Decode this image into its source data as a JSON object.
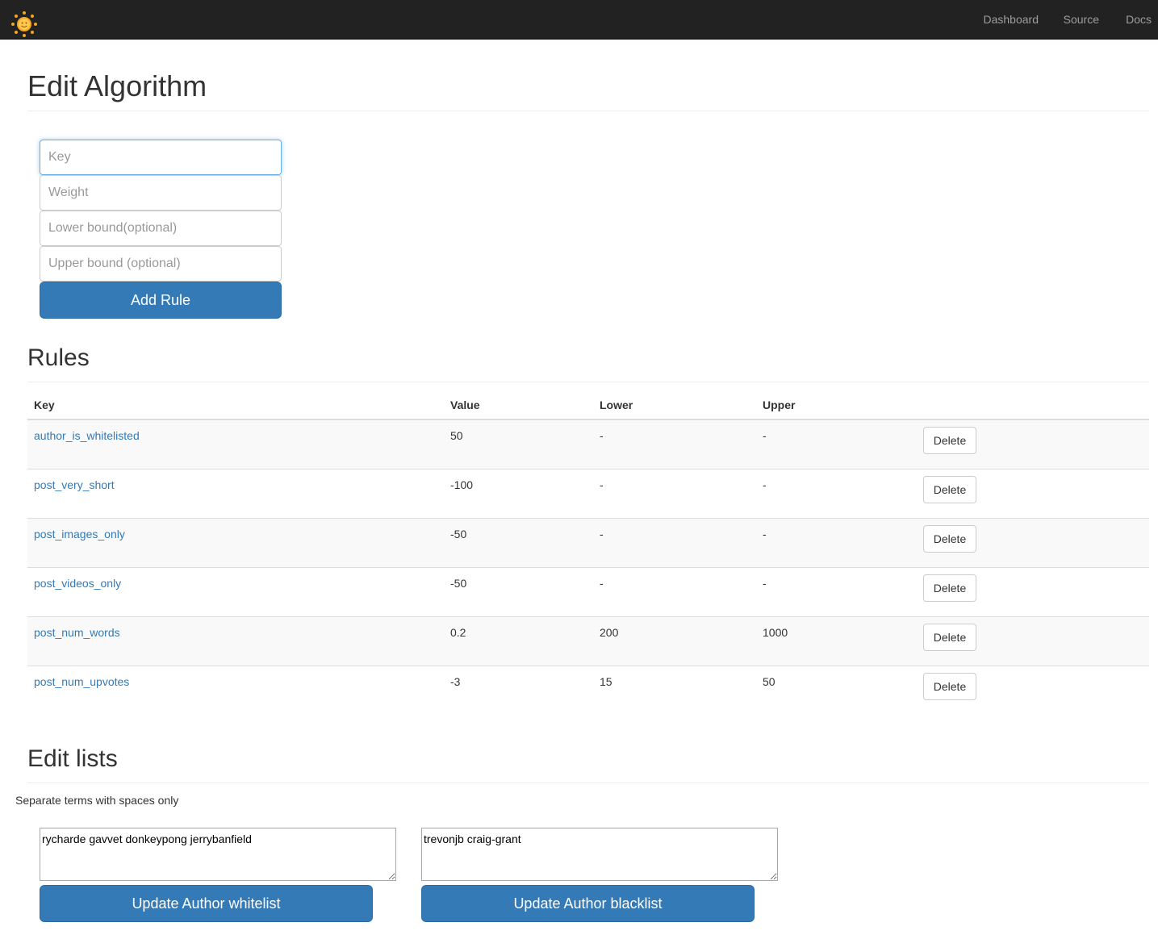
{
  "navbar": {
    "logo_icon": "sun-logo-icon",
    "links": [
      {
        "label": "Dashboard"
      },
      {
        "label": "Source"
      },
      {
        "label": "Docs"
      }
    ]
  },
  "page_title": "Edit Algorithm",
  "form": {
    "key_placeholder": "Key",
    "weight_placeholder": "Weight",
    "lower_placeholder": "Lower bound(optional)",
    "upper_placeholder": "Upper bound (optional)",
    "add_rule_label": "Add Rule"
  },
  "rules": {
    "title": "Rules",
    "columns": {
      "key": "Key",
      "value": "Value",
      "lower": "Lower",
      "upper": "Upper"
    },
    "rows": [
      {
        "key": "author_is_whitelisted",
        "value": "50",
        "lower": "-",
        "upper": "-",
        "action": "Delete"
      },
      {
        "key": "post_very_short",
        "value": "-100",
        "lower": "-",
        "upper": "-",
        "action": "Delete"
      },
      {
        "key": "post_images_only",
        "value": "-50",
        "lower": "-",
        "upper": "-",
        "action": "Delete"
      },
      {
        "key": "post_videos_only",
        "value": "-50",
        "lower": "-",
        "upper": "-",
        "action": "Delete"
      },
      {
        "key": "post_num_words",
        "value": "0.2",
        "lower": "200",
        "upper": "1000",
        "action": "Delete"
      },
      {
        "key": "post_num_upvotes",
        "value": "-3",
        "lower": "15",
        "upper": "50",
        "action": "Delete"
      }
    ]
  },
  "lists": {
    "title": "Edit lists",
    "hint": "Separate terms with spaces only",
    "whitelist_value": "rycharde gavvet donkeypong jerrybanfield",
    "blacklist_value": "trevonjb craig-grant",
    "whitelist_button": "Update Author whitelist",
    "blacklist_button": "Update Author blacklist"
  },
  "colors": {
    "navbar_bg": "#222222",
    "primary": "#337ab7",
    "link": "#337ab7"
  }
}
